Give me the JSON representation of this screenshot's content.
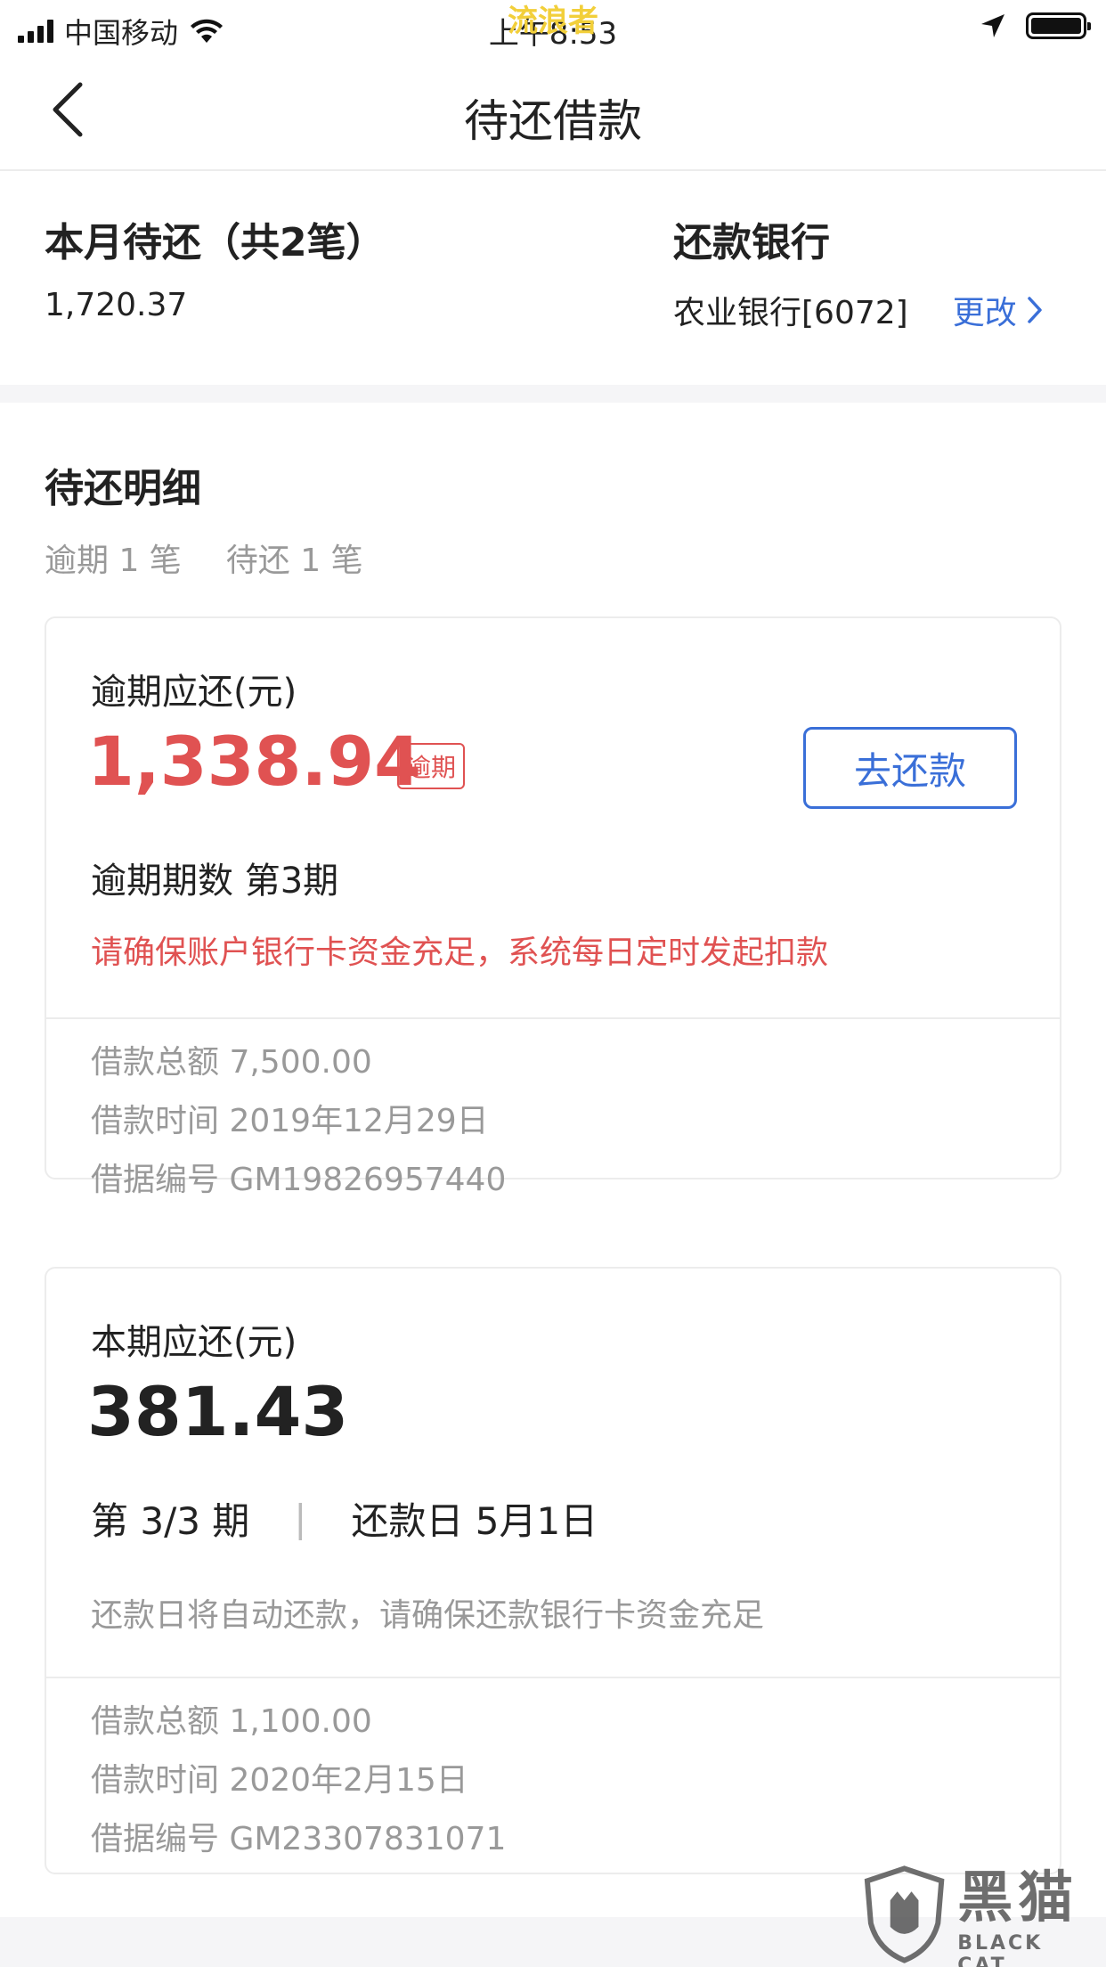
{
  "status_bar": {
    "carrier": "中国移动",
    "time": "上午8:53",
    "watermark": "流浪者"
  },
  "nav": {
    "title": "待还借款"
  },
  "summary": {
    "month_label": "本月待还（共2笔）",
    "month_amount": "1,720.37",
    "bank_label": "还款银行",
    "bank_value": "农业银行[6072]",
    "change_label": "更改"
  },
  "detail": {
    "title": "待还明细",
    "overdue_count": "逾期 1 笔",
    "pending_count": "待还 1 笔"
  },
  "card_overdue": {
    "label": "逾期应还(元)",
    "amount": "1,338.94",
    "badge": "逾期",
    "pay_button": "去还款",
    "periods": "逾期期数 第3期",
    "warning": "请确保账户银行卡资金充足，系统每日定时发起扣款",
    "loan_total": "借款总额 7,500.00",
    "loan_time": "借款时间 2019年12月29日",
    "loan_no": "借据编号 GM19826957440"
  },
  "card_current": {
    "label": "本期应还(元)",
    "amount": "381.43",
    "period": "第 3/3 期",
    "separator": "|",
    "due_date": "还款日 5月1日",
    "hint": "还款日将自动还款，请确保还款银行卡资金充足",
    "loan_total": "借款总额 1,100.00",
    "loan_time": "借款时间 2020年2月15日",
    "loan_no": "借据编号 GM23307831071"
  },
  "watermark_logo": {
    "text": "黑猫",
    "subtext": "BLACK CAT"
  },
  "colors": {
    "accent_blue": "#3a6fd8",
    "overdue_red": "#e05252",
    "muted_gray": "#999999"
  }
}
